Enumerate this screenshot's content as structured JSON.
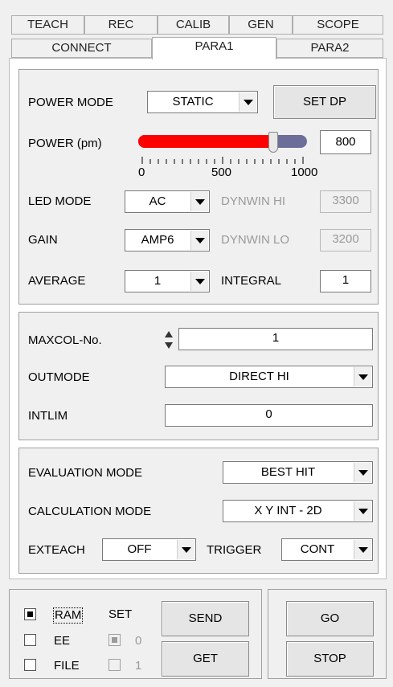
{
  "tabs_row1": [
    "TEACH",
    "REC",
    "CALIB",
    "GEN",
    "SCOPE"
  ],
  "tabs_row2": [
    "CONNECT",
    "PARA1",
    "PARA2"
  ],
  "power_mode": {
    "label": "POWER MODE",
    "value": "STATIC",
    "set_dp": "SET DP"
  },
  "power": {
    "label": "POWER (pm)",
    "value": "800",
    "fraction": 0.8,
    "ticks": [
      "0",
      "500",
      "1000"
    ],
    "fill_color": "#ff0000"
  },
  "led_mode": {
    "label": "LED MODE",
    "value": "AC"
  },
  "dynwin_hi": {
    "label": "DYNWIN HI",
    "value": "3300"
  },
  "gain": {
    "label": "GAIN",
    "value": "AMP6"
  },
  "dynwin_lo": {
    "label": "DYNWIN LO",
    "value": "3200"
  },
  "average": {
    "label": "AVERAGE",
    "value": "1"
  },
  "integral": {
    "label": "INTEGRAL",
    "value": "1"
  },
  "maxcol": {
    "label": "MAXCOL-No.",
    "value": "1"
  },
  "outmode": {
    "label": "OUTMODE",
    "value": "DIRECT HI"
  },
  "intlim": {
    "label": "INTLIM",
    "value": "0"
  },
  "evaluation_mode": {
    "label": "EVALUATION MODE",
    "value": "BEST HIT"
  },
  "calculation_mode": {
    "label": "CALCULATION MODE",
    "value": "X Y INT - 2D"
  },
  "exteach": {
    "label": "EXTEACH",
    "value": "OFF"
  },
  "trigger": {
    "label": "TRIGGER",
    "value": "CONT"
  },
  "memory": {
    "ram": "RAM",
    "ee": "EE",
    "file": "FILE",
    "set": "SET",
    "set0": "0",
    "set1": "1"
  },
  "buttons": {
    "send": "SEND",
    "get": "GET",
    "go": "GO",
    "stop": "STOP"
  }
}
